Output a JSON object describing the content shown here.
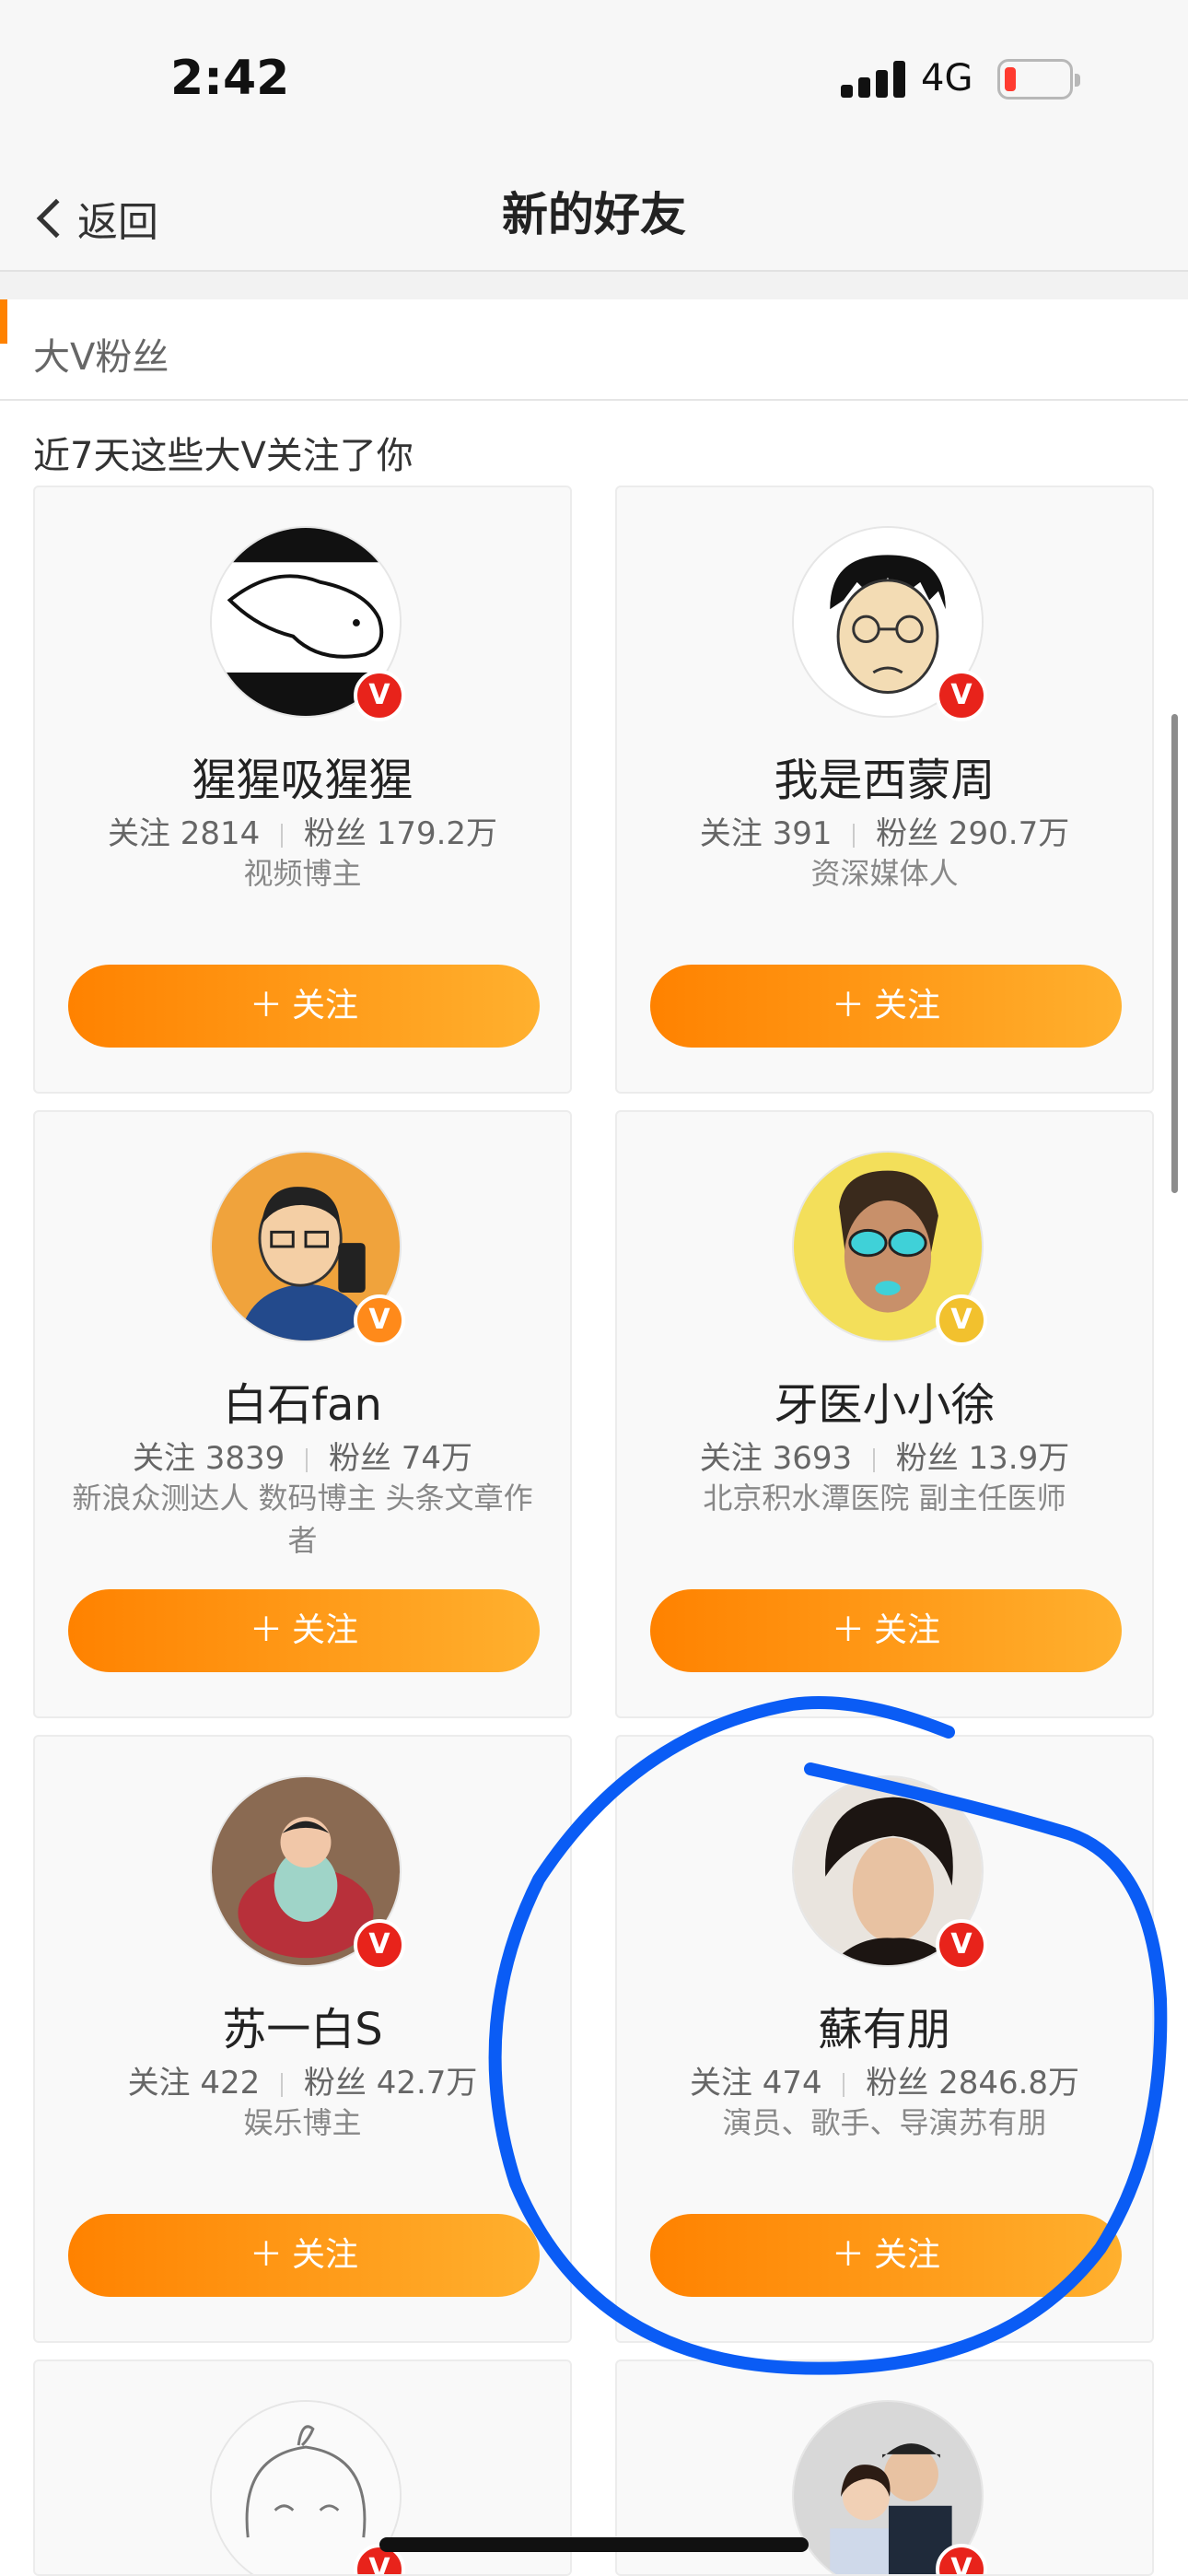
{
  "status_bar": {
    "time": "2:42",
    "network": "4G"
  },
  "nav": {
    "back_label": "返回",
    "title": "新的好友"
  },
  "section": {
    "label": "大V粉丝",
    "subheading": "近7天这些大V关注了你"
  },
  "cards": [
    {
      "name": "猩猩吸猩猩",
      "following_label": "关注",
      "following": "2814",
      "fans_label": "粉丝",
      "fans": "179.2万",
      "desc": "视频博主",
      "follow_label": "关注",
      "badge": "V"
    },
    {
      "name": "我是西蒙周",
      "following_label": "关注",
      "following": "391",
      "fans_label": "粉丝",
      "fans": "290.7万",
      "desc": "资深媒体人",
      "follow_label": "关注",
      "badge": "V"
    },
    {
      "name": "白石fan",
      "following_label": "关注",
      "following": "3839",
      "fans_label": "粉丝",
      "fans": "74万",
      "desc": "新浪众测达人 数码博主 头条文章作者",
      "follow_label": "关注",
      "badge": "V"
    },
    {
      "name": "牙医小小徐",
      "following_label": "关注",
      "following": "3693",
      "fans_label": "粉丝",
      "fans": "13.9万",
      "desc": "北京积水潭医院 副主任医师",
      "follow_label": "关注",
      "badge": "V"
    },
    {
      "name": "苏一白S",
      "following_label": "关注",
      "following": "422",
      "fans_label": "粉丝",
      "fans": "42.7万",
      "desc": "娱乐博主",
      "follow_label": "关注",
      "badge": "V"
    },
    {
      "name": "蘇有朋",
      "following_label": "关注",
      "following": "474",
      "fans_label": "粉丝",
      "fans": "2846.8万",
      "desc": "演员、歌手、导演苏有朋",
      "follow_label": "关注",
      "badge": "V"
    }
  ],
  "colors": {
    "accent": "#ff8200",
    "badge_red": "#e8231b",
    "annotation_blue": "#0a5cf5"
  }
}
